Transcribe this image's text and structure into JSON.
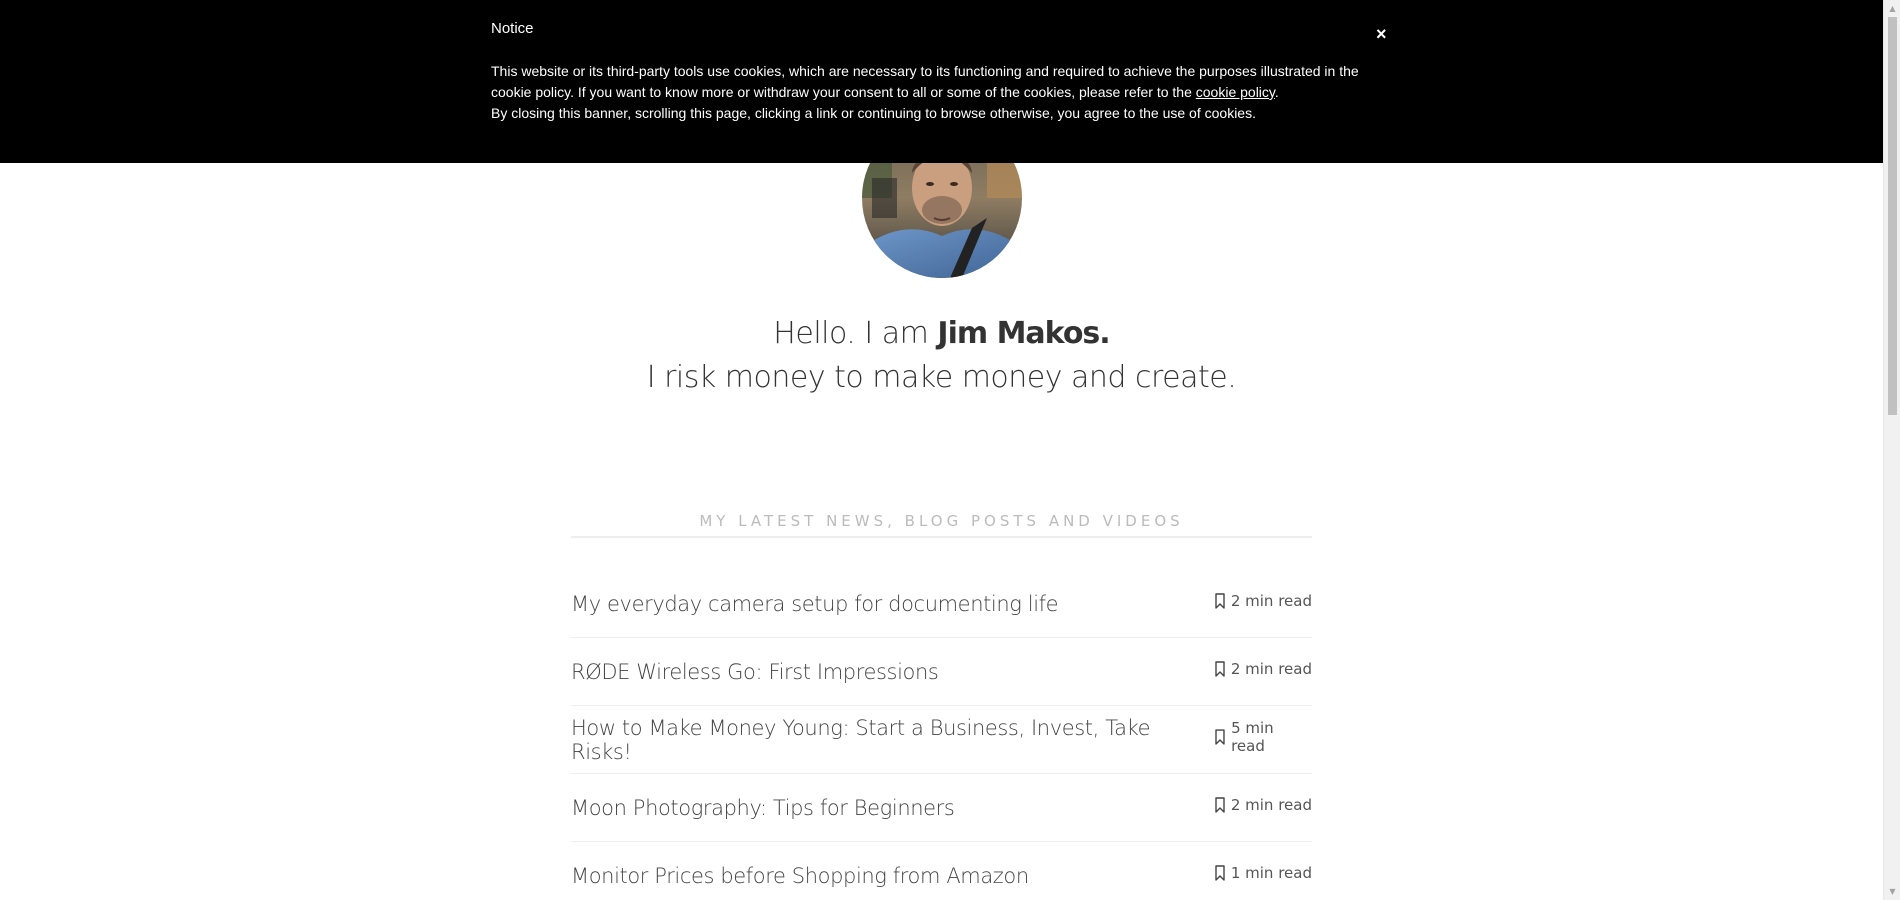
{
  "cookie_banner": {
    "title": "Notice",
    "close_label": "×",
    "text_part1": "This website or its third-party tools use cookies, which are necessary to its functioning and required to achieve the purposes illustrated in the cookie policy. If you want to know more or withdraw your consent to all or some of the cookies, please refer to the ",
    "policy_link": "cookie policy",
    "text_part2": ".",
    "text_line2": "By closing this banner, scrolling this page, clicking a link or continuing to browse otherwise, you agree to the use of cookies."
  },
  "hero": {
    "greeting": "Hello. I am ",
    "name": "Jim Makos.",
    "tagline": "I risk money to make money and create."
  },
  "section": {
    "title": "MY LATEST NEWS, BLOG POSTS AND VIDEOS"
  },
  "posts": [
    {
      "title": "My everyday camera setup for documenting life",
      "read_time": "2 min read"
    },
    {
      "title": "RØDE Wireless Go: First Impressions",
      "read_time": "2 min read"
    },
    {
      "title": "How to Make Money Young: Start a Business, Invest, Take Risks!",
      "read_time": "5 min read"
    },
    {
      "title": "Moon Photography: Tips for Beginners",
      "read_time": "2 min read"
    },
    {
      "title": "Monitor Prices before Shopping from Amazon",
      "read_time": "1 min read"
    }
  ],
  "icons": {
    "bookmark": "bookmark-icon",
    "close": "close-icon"
  }
}
